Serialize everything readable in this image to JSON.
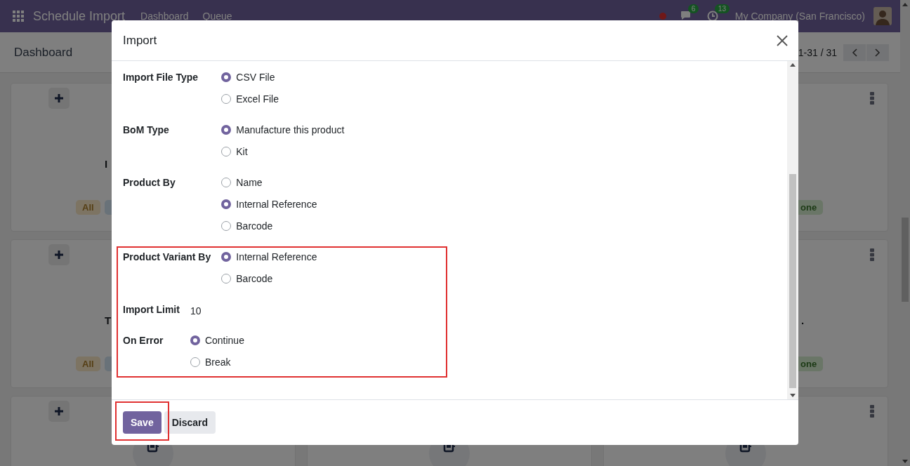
{
  "navbar": {
    "app_name": "Schedule Import",
    "menus": [
      "Dashboard",
      "Queue"
    ],
    "chat_count": "6",
    "activity_count": "13",
    "company": "My Company (San Francisco)"
  },
  "control_panel": {
    "title": "Dashboard",
    "pager": "1-31 / 31"
  },
  "cards": [
    {
      "kind": "add",
      "title": "I",
      "badges": [
        {
          "label": "All",
          "color": "#7d7463"
        },
        {
          "color": "#697279"
        }
      ]
    },
    {
      "kind": "blank"
    },
    {
      "kind": "menu",
      "badges": [
        {
          "label": "one",
          "color": "#6a7667"
        }
      ]
    },
    {
      "kind": "add",
      "title": "T",
      "badges": [
        {
          "label": "All",
          "color": "#7d7463"
        },
        {
          "color": "#697279"
        }
      ]
    },
    {
      "kind": "blank"
    },
    {
      "kind": "menu",
      "title": ".",
      "badges": [
        {
          "label": "one",
          "color": "#6a7667"
        }
      ]
    },
    {
      "kind": "add",
      "emblem": true
    },
    {
      "kind": "plain",
      "emblem": true
    },
    {
      "kind": "menu",
      "emblem": true
    }
  ],
  "dialog": {
    "title": "Import",
    "groups": [
      {
        "fields": [
          {
            "label": "Import File Type",
            "kind": "radio",
            "options": [
              {
                "label": "CSV File",
                "selected": true
              },
              {
                "label": "Excel File",
                "selected": false
              }
            ]
          },
          {
            "label": "BoM Type",
            "kind": "radio",
            "options": [
              {
                "label": "Manufacture this product",
                "selected": true
              },
              {
                "label": "Kit",
                "selected": false
              }
            ]
          },
          {
            "label": "Product By",
            "kind": "radio",
            "options": [
              {
                "label": "Name",
                "selected": false
              },
              {
                "label": "Internal Reference",
                "selected": true
              },
              {
                "label": "Barcode",
                "selected": false
              }
            ]
          },
          {
            "label": "Product Variant By",
            "kind": "radio",
            "options": [
              {
                "label": "Internal Reference",
                "selected": true
              },
              {
                "label": "Barcode",
                "selected": false
              }
            ]
          }
        ]
      },
      {
        "fields": [
          {
            "label": "Import Limit",
            "kind": "text",
            "value": "10"
          },
          {
            "label": "On Error",
            "kind": "radio",
            "options": [
              {
                "label": "Continue",
                "selected": true
              },
              {
                "label": "Break",
                "selected": false
              }
            ]
          }
        ]
      }
    ],
    "buttons": [
      {
        "label": "Save",
        "kind": "primary"
      },
      {
        "label": "Discard",
        "kind": "secondary"
      }
    ]
  }
}
